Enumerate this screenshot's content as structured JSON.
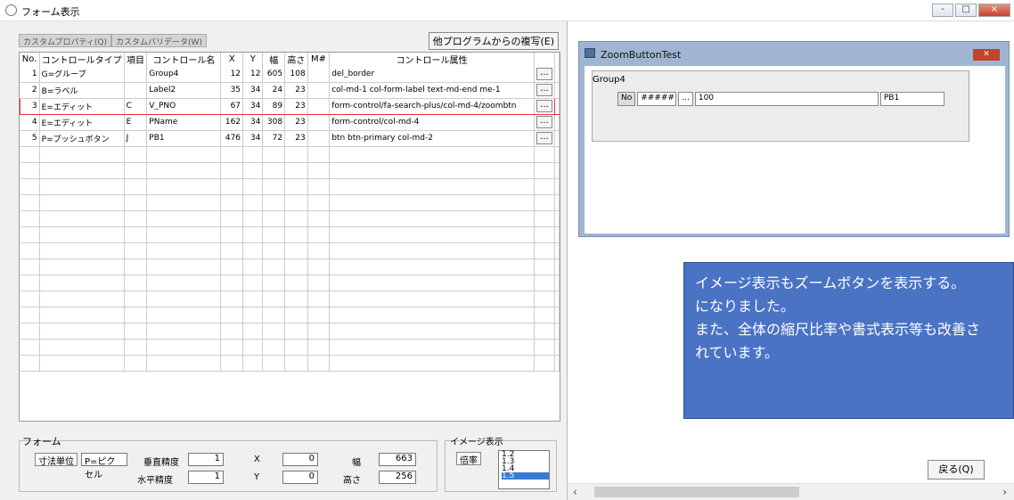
{
  "window": {
    "title": "フォーム表示",
    "buttons": [
      "-",
      "□",
      "×"
    ]
  },
  "tabs": [
    "カスタムプロパティ(Q)",
    "カスタムパリデータ(W)"
  ],
  "copy_button": "他プログラムからの複写(E)",
  "grid": {
    "headers": [
      "No.",
      "コントロールタイプ",
      "項目",
      "コントロール名",
      "X",
      "Y",
      "幅",
      "高さ",
      "M#",
      "コントロール属性"
    ],
    "rows": [
      [
        "1",
        "G=グループ",
        "",
        "Group4",
        "12",
        "12",
        "605",
        "108",
        "",
        "del_border"
      ],
      [
        "2",
        "B=ラベル",
        "",
        "Label2",
        "35",
        "34",
        "24",
        "23",
        "",
        "col-md-1 col-form-label text-md-end me-1"
      ],
      [
        "3",
        "E=エディット",
        "C",
        "V_PNO",
        "67",
        "34",
        "89",
        "23",
        "",
        "form-control/fa-search-plus/col-md-4/zoombtn"
      ],
      [
        "4",
        "E=エディット",
        "E",
        "PName",
        "162",
        "34",
        "308",
        "23",
        "",
        "form-control/col-md-4"
      ],
      [
        "5",
        "P=プッシュボタン",
        "J",
        "PB1",
        "476",
        "34",
        "72",
        "23",
        "",
        "btn btn-primary col-md-2"
      ]
    ],
    "ellipsis": "..."
  },
  "form_group": {
    "label": "フォーム",
    "unit_button": "寸法単位",
    "unit_value": "P=ピクセル",
    "vertical_label": "垂直精度",
    "vertical_value": "1",
    "horizontal_label": "水平精度",
    "horizontal_value": "1",
    "x_label": "X",
    "x_value": "0",
    "y_label": "Y",
    "y_value": "0",
    "width_label": "幅",
    "width_value": "663",
    "height_label": "高さ",
    "height_value": "256"
  },
  "image_group": {
    "label": "イメージ表示",
    "zoom_button": "倍率",
    "options": [
      "1.2",
      "1.3",
      "1.4",
      "1.5"
    ],
    "selected": "1.5"
  },
  "zoom_window": {
    "title": "ZoomButtonTest",
    "group_label": "Group4",
    "no_label": "No",
    "field1": "#####",
    "ellipsis": "...",
    "field2": "100",
    "pb1": "PB1"
  },
  "note": {
    "lines": [
      "イメージ表示もズームボタンを表示する。",
      "になりました。",
      "また、全体の縮尺比率や書式表示等も改善さ",
      "れています。"
    ],
    "color": "#4a73c4"
  },
  "back_button": "戻る(Q)"
}
